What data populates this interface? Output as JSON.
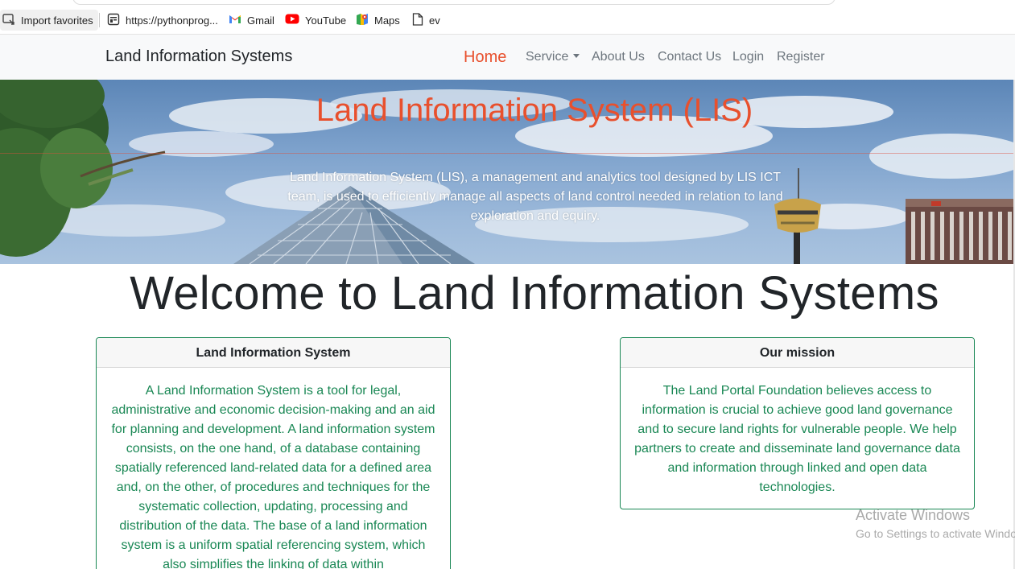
{
  "bookmarks": [
    {
      "label": "Import favorites",
      "icon": "import-icon"
    },
    {
      "label": "https://pythonprog...",
      "icon": "page-icon"
    },
    {
      "label": "Gmail",
      "icon": "gmail-icon"
    },
    {
      "label": "YouTube",
      "icon": "youtube-icon"
    },
    {
      "label": "Maps",
      "icon": "maps-icon"
    },
    {
      "label": "ev",
      "icon": "document-icon"
    }
  ],
  "navbar": {
    "brand": "Land Information Systems",
    "items": [
      "Home",
      "Service",
      "About Us",
      "Contact Us",
      "Login",
      "Register"
    ]
  },
  "hero": {
    "title": "Land Information System (LIS)",
    "text": "Land Information System (LIS), a management and analytics tool designed by LIS ICT team, is used to efficiently manage all aspects of land control needed in relation to land exploration and equiry."
  },
  "welcome": "Welcome to Land Information Systems",
  "cards": [
    {
      "title": "Land Information System",
      "body": "A Land Information System is a tool for legal, administrative and economic decision-making and an aid for planning and development. A land information system consists, on the one hand, of a database containing spatially referenced land-related data for a defined area and, on the other, of procedures and techniques for the systematic collection, updating, processing and distribution of the data. The base of a land information system is a uniform spatial referencing system, which also simplifies the linking of data within"
    },
    {
      "title": "Our mission",
      "body": "The Land Portal Foundation believes access to information is crucial to achieve good land governance and to secure land rights for vulnerable people. We help partners to create and disseminate land governance data and information through linked and open data technologies."
    }
  ],
  "watermark": {
    "line1": "Activate Windows",
    "line2": "Go to Settings to activate Windows."
  },
  "colors": {
    "accent": "#e8502d",
    "card_text": "#198754",
    "navbar_bg": "#f8f9fa"
  }
}
